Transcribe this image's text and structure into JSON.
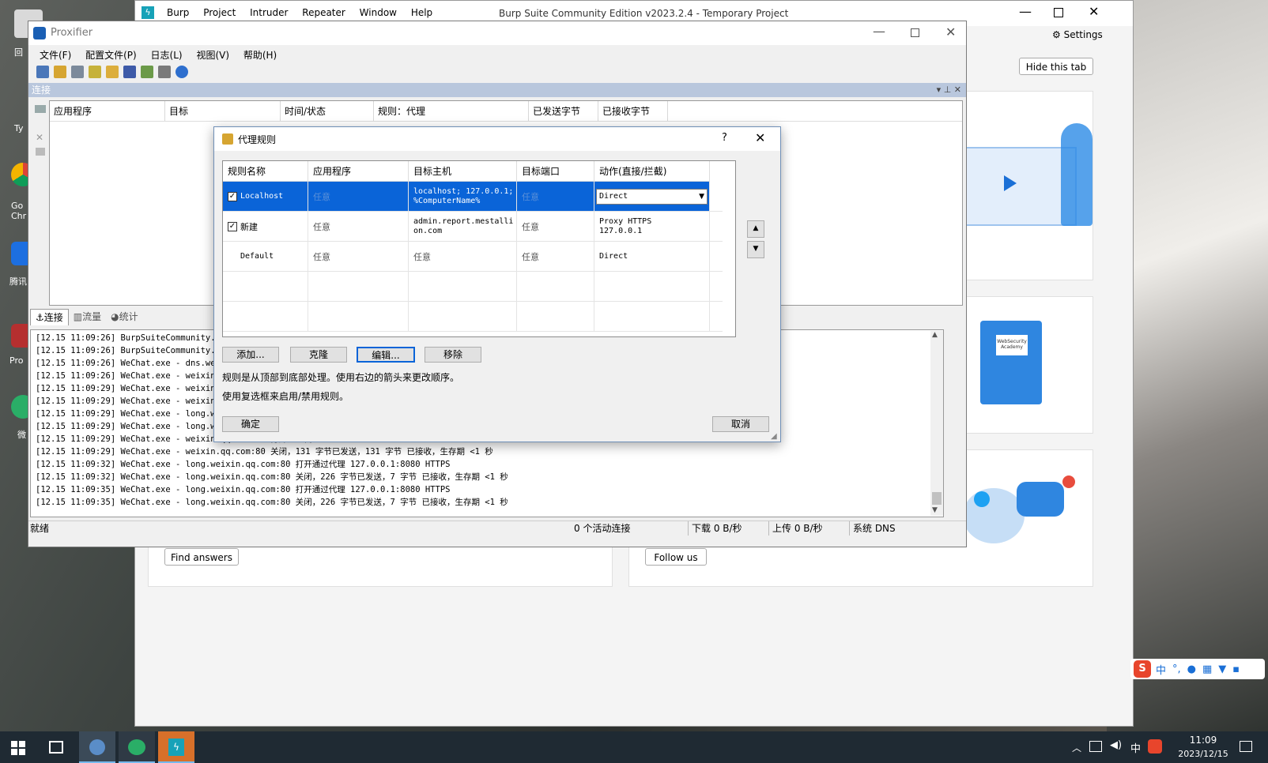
{
  "desktop": {
    "icons": [
      {
        "label": "回"
      },
      {
        "label": "Ty"
      },
      {
        "label": "Go Chr"
      },
      {
        "label": "腾讯"
      },
      {
        "label": "Pro"
      },
      {
        "label": "微"
      }
    ]
  },
  "burp": {
    "menu": [
      "Burp",
      "Project",
      "Intruder",
      "Repeater",
      "Window",
      "Help"
    ],
    "title": "Burp Suite Community Edition v2023.2.4 - Temporary Project",
    "settings": "Settings",
    "hide_tab": "Hide this tab",
    "find_answers": "Find answers",
    "follow_us": "Follow us",
    "book_label": "WebSecurity Academy"
  },
  "proxifier": {
    "title": "Proxifier",
    "menu": [
      "文件(F)",
      "配置文件(P)",
      "日志(L)",
      "视图(V)",
      "帮助(H)"
    ],
    "panel_title": "连接",
    "columns": [
      "应用程序",
      "目标",
      "时间/状态",
      "规则：代理",
      "已发送字节",
      "已接收字节"
    ],
    "tabs": [
      "连接",
      "流量",
      "统计"
    ],
    "log": [
      "[12.15 11:09:26] BurpSuiteCommunity.e",
      "[12.15 11:09:26] BurpSuiteCommunity.e",
      "[12.15 11:09:26] WeChat.exe - dns.wei",
      "[12.15 11:09:26] WeChat.exe - weixin.",
      "[12.15 11:09:29] WeChat.exe - weixin.",
      "[12.15 11:09:29] WeChat.exe - weixin.",
      "[12.15 11:09:29] WeChat.exe - long.wei",
      "[12.15 11:09:29] WeChat.exe - long.we",
      "[12.15 11:09:29] WeChat.exe - weixin.qq.com:80 打开通过代理 127.0.0.1:8080 HTTPS",
      "[12.15 11:09:29] WeChat.exe - weixin.qq.com:80 关闭，131 字节已发送，131 字节 已接收，生存期 <1 秒",
      "[12.15 11:09:32] WeChat.exe - long.weixin.qq.com:80 打开通过代理 127.0.0.1:8080 HTTPS",
      "[12.15 11:09:32] WeChat.exe - long.weixin.qq.com:80 关闭，226 字节已发送，7 字节 已接收，生存期 <1 秒",
      "[12.15 11:09:35] WeChat.exe - long.weixin.qq.com:80 打开通过代理 127.0.0.1:8080 HTTPS",
      "[12.15 11:09:35] WeChat.exe - long.weixin.qq.com:80 关闭，226 字节已发送，7 字节 已接收，生存期 <1 秒"
    ],
    "status": {
      "ready": "就绪",
      "active": "0 个活动连接",
      "down": "下载 0 B/秒",
      "up": "上传 0 B/秒",
      "dns": "系统 DNS"
    }
  },
  "dialog": {
    "title": "代理规则",
    "help": "?",
    "headers": [
      "规则名称",
      "应用程序",
      "目标主机",
      "目标端口",
      "动作(直接/拦截)"
    ],
    "rows": [
      {
        "name": "Localhost",
        "app": "任意",
        "host": "localhost; 127.0.0.1; %ComputerName%",
        "port": "任意",
        "action": "Direct"
      },
      {
        "name": "新建",
        "app": "任意",
        "host": "admin.report.mestallion.com",
        "port": "任意",
        "action": "Proxy HTTPS 127.0.0.1"
      },
      {
        "name": "Default",
        "app": "任意",
        "host": "任意",
        "port": "任意",
        "action": "Direct"
      }
    ],
    "buttons": {
      "add": "添加...",
      "clone": "克隆",
      "edit": "编辑...",
      "remove": "移除",
      "ok": "确定",
      "cancel": "取消"
    },
    "hint1": "规则是从顶部到底部处理。使用右边的箭头来更改顺序。",
    "hint2": "使用复选框来启用/禁用规则。"
  },
  "ime": {
    "lang": "中"
  },
  "taskbar": {
    "time": "11:09",
    "date": "2023/12/15",
    "ime": "中"
  }
}
